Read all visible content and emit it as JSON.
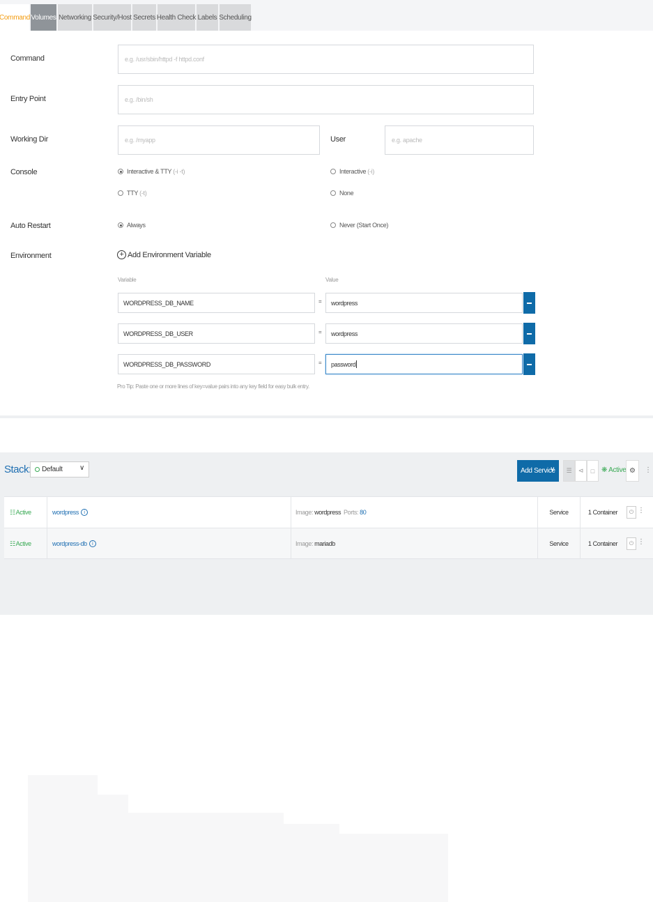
{
  "tabs": [
    {
      "label": "Command",
      "state": "active"
    },
    {
      "label": "Volumes",
      "state": "hover"
    },
    {
      "label": "Networking",
      "state": "normal"
    },
    {
      "label": "Security/Host",
      "state": "normal"
    },
    {
      "label": "Secrets",
      "state": "normal"
    },
    {
      "label": "Health Check",
      "state": "normal"
    },
    {
      "label": "Labels",
      "state": "normal"
    },
    {
      "label": "Scheduling",
      "state": "normal"
    }
  ],
  "form": {
    "command": {
      "label": "Command",
      "placeholder": "e.g. /usr/sbin/httpd -f httpd.conf"
    },
    "entrypoint": {
      "label": "Entry Point",
      "placeholder": "e.g. /bin/sh"
    },
    "workdir": {
      "label": "Working Dir",
      "placeholder": "e.g. /myapp"
    },
    "user": {
      "label": "User",
      "placeholder": "e.g. apache"
    },
    "console": {
      "label": "Console",
      "options": [
        {
          "label": "Interactive & TTY",
          "flag": "(-i -t)",
          "checked": true
        },
        {
          "label": "Interactive",
          "flag": "(-i)",
          "checked": false
        },
        {
          "label": "TTY",
          "flag": "(-t)",
          "checked": false
        },
        {
          "label": "None",
          "flag": "",
          "checked": false
        }
      ]
    },
    "restart": {
      "label": "Auto Restart",
      "options": [
        {
          "label": "Always",
          "checked": true
        },
        {
          "label": "Never (Start Once)",
          "checked": false
        }
      ]
    },
    "environment": {
      "label": "Environment",
      "add_label": "Add Environment Variable",
      "variable_head": "Variable",
      "value_head": "Value",
      "equals": "=",
      "rows": [
        {
          "key": "WORDPRESS_DB_NAME",
          "value": "wordpress"
        },
        {
          "key": "WORDPRESS_DB_USER",
          "value": "wordpress"
        },
        {
          "key": "WORDPRESS_DB_PASSWORD",
          "value": "password"
        }
      ],
      "protip": "Pro Tip: Paste one or more lines of key=value pairs into any key field for easy bulk entry."
    }
  },
  "stack": {
    "title": "Stack:",
    "selected": "Default",
    "add_service": "Add Service",
    "state": "Active",
    "services": [
      {
        "status": "Active",
        "name": "wordpress",
        "image_label": "Image:",
        "image": "wordpress",
        "ports_label": "Ports:",
        "ports": "80",
        "kind": "Service",
        "containers": "1 Container"
      },
      {
        "status": "Active",
        "name": "wordpress-db",
        "image_label": "Image:",
        "image": "mariadb",
        "ports_label": "",
        "ports": "",
        "kind": "Service",
        "containers": "1 Container"
      }
    ]
  },
  "colors": {
    "accent": "#f39c12",
    "primary": "#0f6ba8",
    "success": "#3aaa55",
    "link": "#1f6fb2"
  }
}
